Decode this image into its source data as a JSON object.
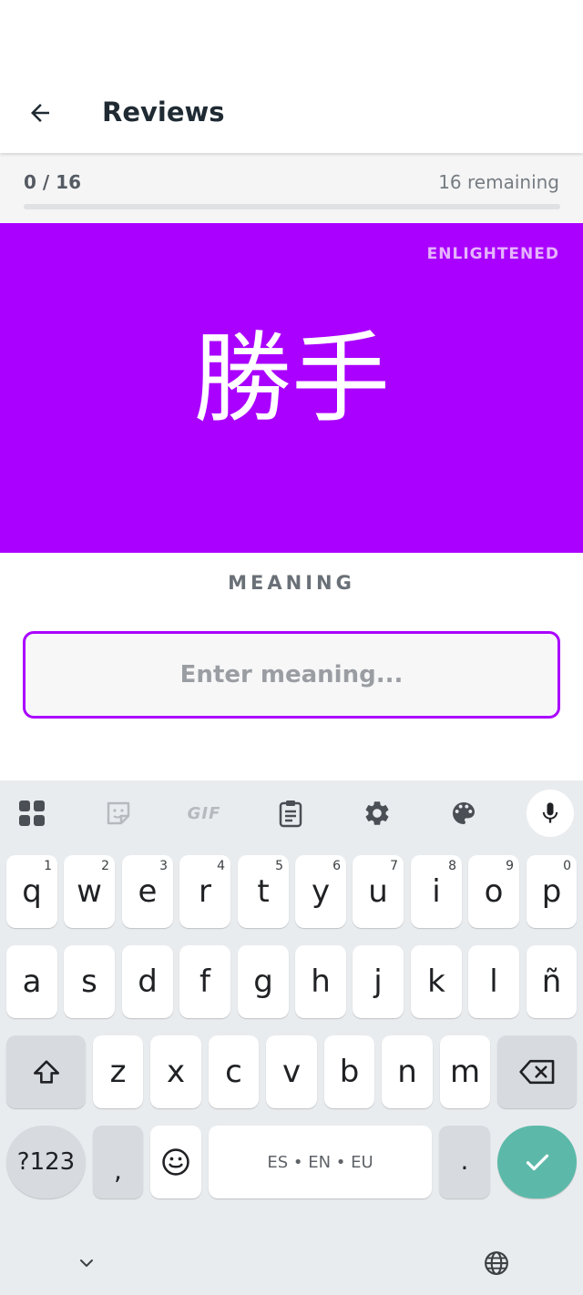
{
  "appbar": {
    "back_icon": "arrow-left-icon",
    "title": "Reviews"
  },
  "progress": {
    "count": "0 / 16",
    "remaining": "16 remaining",
    "fraction": 0.0,
    "fill_color": "#9b00ff"
  },
  "card": {
    "background": "#aa00ff",
    "srs_level": "ENLIGHTENED",
    "subject": "勝手"
  },
  "answer": {
    "question_type": "MEANING",
    "value": "",
    "placeholder": "Enter meaning...",
    "border_color": "#aa00ff"
  },
  "keyboard": {
    "toolbar": [
      {
        "name": "apps-grid-icon"
      },
      {
        "name": "sticker-icon"
      },
      {
        "name": "gif-icon",
        "label": "GIF"
      },
      {
        "name": "clipboard-icon"
      },
      {
        "name": "settings-gear-icon"
      },
      {
        "name": "palette-icon"
      },
      {
        "name": "microphone-icon"
      }
    ],
    "row1": [
      {
        "char": "q",
        "hint": "1"
      },
      {
        "char": "w",
        "hint": "2"
      },
      {
        "char": "e",
        "hint": "3"
      },
      {
        "char": "r",
        "hint": "4"
      },
      {
        "char": "t",
        "hint": "5"
      },
      {
        "char": "y",
        "hint": "6"
      },
      {
        "char": "u",
        "hint": "7"
      },
      {
        "char": "i",
        "hint": "8"
      },
      {
        "char": "o",
        "hint": "9"
      },
      {
        "char": "p",
        "hint": "0"
      }
    ],
    "row2": [
      "a",
      "s",
      "d",
      "f",
      "g",
      "h",
      "j",
      "k",
      "l",
      "ñ"
    ],
    "row3": [
      "z",
      "x",
      "c",
      "v",
      "b",
      "n",
      "m"
    ],
    "symbols_label": "?123",
    "comma": ",",
    "space_label": "ES • EN • EU",
    "period": ".",
    "shift_icon": "shift-arrow-icon",
    "backspace_icon": "backspace-icon",
    "emoji_icon": "emoji-smile-icon",
    "enter_icon": "checkmark-icon",
    "hide_icon": "chevron-down-icon",
    "language_icon": "globe-icon",
    "enter_color": "#5cb9a9"
  }
}
